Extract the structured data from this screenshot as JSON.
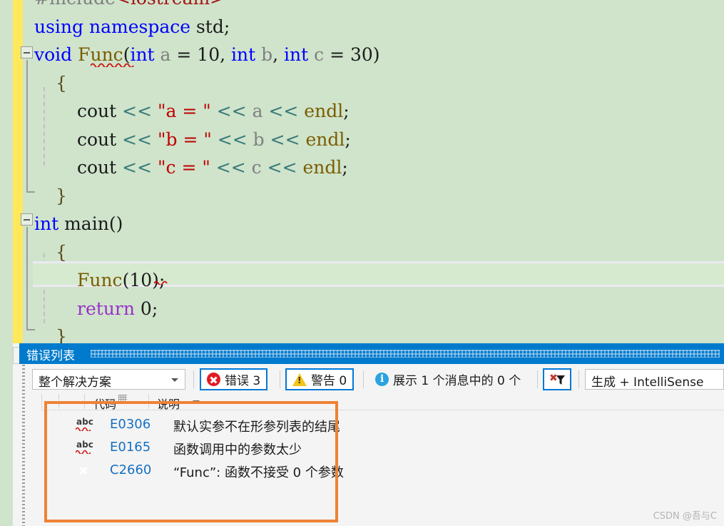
{
  "editor": {
    "lines": [
      {
        "indent": 0,
        "tokens": [
          {
            "t": "#include",
            "c": "pre"
          },
          {
            "t": "<iostream>",
            "c": "hdr"
          }
        ]
      },
      {
        "indent": 0,
        "tokens": [
          {
            "t": "using namespace ",
            "c": "kw"
          },
          {
            "t": "std",
            "c": "plain"
          },
          {
            "t": ";",
            "c": "punct"
          }
        ]
      },
      {
        "indent": 0,
        "tokens": [
          {
            "t": "void ",
            "c": "kw"
          },
          {
            "t": "Func",
            "c": "fn"
          },
          {
            "t": "(",
            "c": "punct"
          },
          {
            "t": "int ",
            "c": "kw"
          },
          {
            "t": "a",
            "c": "id"
          },
          {
            "t": " = ",
            "c": "punct"
          },
          {
            "t": "10",
            "c": "num"
          },
          {
            "t": ", ",
            "c": "punct"
          },
          {
            "t": "int ",
            "c": "kw"
          },
          {
            "t": "b",
            "c": "id"
          },
          {
            "t": ", ",
            "c": "punct"
          },
          {
            "t": "int ",
            "c": "kw"
          },
          {
            "t": "c",
            "c": "id"
          },
          {
            "t": " = ",
            "c": "punct"
          },
          {
            "t": "30",
            "c": "num"
          },
          {
            "t": ")",
            "c": "punct"
          }
        ]
      },
      {
        "indent": 1,
        "tokens": [
          {
            "t": "{",
            "c": "brace"
          }
        ]
      },
      {
        "indent": 2,
        "tokens": [
          {
            "t": "cout ",
            "c": "plain"
          },
          {
            "t": "<<",
            "c": "op"
          },
          {
            "t": " ",
            "c": "plain"
          },
          {
            "t": "\"a = \"",
            "c": "str"
          },
          {
            "t": " ",
            "c": "plain"
          },
          {
            "t": "<<",
            "c": "op"
          },
          {
            "t": " ",
            "c": "plain"
          },
          {
            "t": "a",
            "c": "id"
          },
          {
            "t": " ",
            "c": "plain"
          },
          {
            "t": "<<",
            "c": "op"
          },
          {
            "t": " ",
            "c": "plain"
          },
          {
            "t": "endl",
            "c": "fn"
          },
          {
            "t": ";",
            "c": "punct"
          }
        ]
      },
      {
        "indent": 2,
        "tokens": [
          {
            "t": "cout ",
            "c": "plain"
          },
          {
            "t": "<<",
            "c": "op"
          },
          {
            "t": " ",
            "c": "plain"
          },
          {
            "t": "\"b = \"",
            "c": "str"
          },
          {
            "t": " ",
            "c": "plain"
          },
          {
            "t": "<<",
            "c": "op"
          },
          {
            "t": " ",
            "c": "plain"
          },
          {
            "t": "b",
            "c": "id"
          },
          {
            "t": " ",
            "c": "plain"
          },
          {
            "t": "<<",
            "c": "op"
          },
          {
            "t": " ",
            "c": "plain"
          },
          {
            "t": "endl",
            "c": "fn"
          },
          {
            "t": ";",
            "c": "punct"
          }
        ]
      },
      {
        "indent": 2,
        "tokens": [
          {
            "t": "cout ",
            "c": "plain"
          },
          {
            "t": "<<",
            "c": "op"
          },
          {
            "t": " ",
            "c": "plain"
          },
          {
            "t": "\"c = \"",
            "c": "str"
          },
          {
            "t": " ",
            "c": "plain"
          },
          {
            "t": "<<",
            "c": "op"
          },
          {
            "t": " ",
            "c": "plain"
          },
          {
            "t": "c",
            "c": "id"
          },
          {
            "t": " ",
            "c": "plain"
          },
          {
            "t": "<<",
            "c": "op"
          },
          {
            "t": " ",
            "c": "plain"
          },
          {
            "t": "endl",
            "c": "fn"
          },
          {
            "t": ";",
            "c": "punct"
          }
        ]
      },
      {
        "indent": 1,
        "tokens": [
          {
            "t": "}",
            "c": "brace"
          }
        ]
      },
      {
        "indent": 0,
        "tokens": [
          {
            "t": "int ",
            "c": "kw"
          },
          {
            "t": "main",
            "c": "plain"
          },
          {
            "t": "()",
            "c": "punct"
          }
        ]
      },
      {
        "indent": 1,
        "tokens": [
          {
            "t": "{",
            "c": "brace"
          }
        ]
      },
      {
        "indent": 2,
        "tokens": [
          {
            "t": "Func",
            "c": "fn"
          },
          {
            "t": "(",
            "c": "punct"
          },
          {
            "t": "10",
            "c": "num"
          },
          {
            "t": ")",
            "c": "punct"
          },
          {
            "t": ";",
            "c": "punct"
          }
        ]
      },
      {
        "indent": 2,
        "tokens": [
          {
            "t": "return",
            "c": "ret"
          },
          {
            "t": " ",
            "c": "plain"
          },
          {
            "t": "0",
            "c": "num"
          },
          {
            "t": ";",
            "c": "punct"
          }
        ]
      },
      {
        "indent": 1,
        "tokens": [
          {
            "t": "}",
            "c": "brace"
          }
        ]
      }
    ]
  },
  "panel": {
    "title": "错误列表",
    "toolbar": {
      "scope_value": "整个解决方案",
      "errors_label": "错误 3",
      "warnings_label": "警告 0",
      "messages_label": "展示 1 个消息中的 0 个",
      "clear_filter_label": "",
      "build_filter_value": "生成 + IntelliSense"
    },
    "columns": {
      "code": "代码",
      "description": "说明"
    },
    "rows": [
      {
        "icon": "intellisense-squiggle-icon",
        "code": "E0306",
        "description": "默认实参不在形参列表的结尾"
      },
      {
        "icon": "intellisense-squiggle-icon",
        "code": "E0165",
        "description": "函数调用中的参数太少"
      },
      {
        "icon": "error-icon",
        "code": "C2660",
        "description": "“Func”: 函数不接受 0 个参数"
      }
    ]
  },
  "watermark": "CSDN @吾与C",
  "colors": {
    "editor_background": "#cfe4cb",
    "change_bar": "#ffe85c",
    "panel_title_background": "#007acc",
    "annotation_border": "#ef8235",
    "error_red": "#e01b24",
    "warning_yellow": "#f5c518",
    "info_blue": "#2aa3e0",
    "code_link_blue": "#1570c4"
  }
}
